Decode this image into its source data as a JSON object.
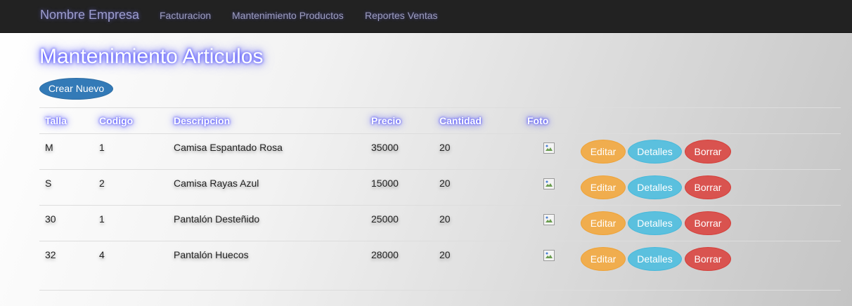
{
  "navbar": {
    "brand": "Nombre Empresa",
    "links": [
      "Facturacion",
      "Mantenimiento Productos",
      "Reportes Ventas"
    ]
  },
  "page": {
    "title": "Mantenimiento Articulos",
    "create_label": "Crear Nuevo"
  },
  "table": {
    "headers": [
      "Talla",
      "Codigo",
      "Descripcion",
      "Precio",
      "Cantidad",
      "Foto"
    ],
    "rows": [
      [
        "M",
        "1",
        "Camisa Espantado Rosa",
        "35000",
        "20"
      ],
      [
        "S",
        "2",
        "Camisa Rayas Azul",
        "15000",
        "20"
      ],
      [
        "30",
        "1",
        "Pantalón Desteñido",
        "25000",
        "20"
      ],
      [
        "32",
        "4",
        "Pantalón Huecos",
        "28000",
        "20"
      ]
    ],
    "actions": {
      "edit": "Editar",
      "details": "Detalles",
      "delete": "Borrar"
    }
  },
  "icons": {
    "photo": "broken-image-icon"
  },
  "colors": {
    "primary": "#337ab7",
    "warning": "#f0ad4e",
    "info": "#5bc0de",
    "danger": "#d9534f",
    "navbar": "#222222"
  }
}
